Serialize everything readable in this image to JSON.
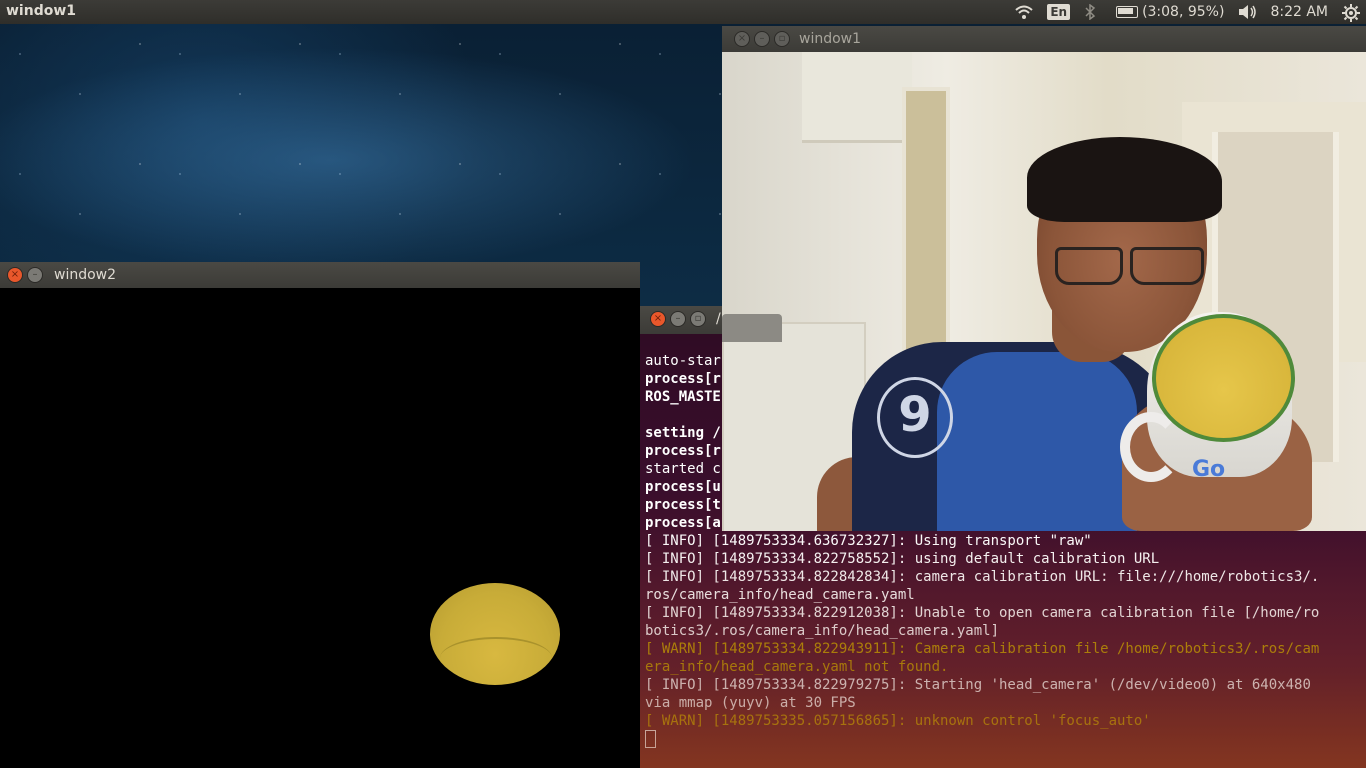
{
  "top_panel": {
    "app_title": "window1",
    "keyboard_layout": "En",
    "battery_text": "(3:08, 95%)",
    "clock": "8:22 AM",
    "icons": [
      "wifi-icon",
      "keyboard-layout-indicator",
      "bluetooth-icon",
      "battery-icon",
      "volume-icon",
      "settings-gear-icon"
    ]
  },
  "window1": {
    "title": "window1",
    "content": "webcam-feed",
    "mug_text": "Go"
  },
  "window2": {
    "title": "window2",
    "content": "thresholded-mask"
  },
  "terminal": {
    "title_fragment": "/",
    "lines": [
      {
        "text": "auto-star",
        "style": "normal"
      },
      {
        "text": "process[r",
        "style": "bold"
      },
      {
        "text": "ROS_MASTE",
        "style": "bold"
      },
      {
        "text": "",
        "style": "normal"
      },
      {
        "text": "setting /",
        "style": "bold"
      },
      {
        "text": "process[r",
        "style": "bold"
      },
      {
        "text": "started c",
        "style": "normal"
      },
      {
        "text": "process[u",
        "style": "bold"
      },
      {
        "text": "process[t",
        "style": "bold"
      },
      {
        "text": "process[a",
        "style": "bold"
      },
      {
        "text": "[ INFO] [1489753334.636732327]: Using transport \"raw\"",
        "style": "normal"
      },
      {
        "text": "[ INFO] [1489753334.822758552]: using default calibration URL",
        "style": "normal"
      },
      {
        "text": "[ INFO] [1489753334.822842834]: camera calibration URL: file:///home/robotics3/.",
        "style": "normal"
      },
      {
        "text": "ros/camera_info/head_camera.yaml",
        "style": "normal"
      },
      {
        "text": "[ INFO] [1489753334.822912038]: Unable to open camera calibration file [/home/ro",
        "style": "normal"
      },
      {
        "text": "botics3/.ros/camera_info/head_camera.yaml]",
        "style": "normal"
      },
      {
        "text": "[ WARN] [1489753334.822943911]: Camera calibration file /home/robotics3/.ros/cam",
        "style": "warn"
      },
      {
        "text": "era_info/head_camera.yaml not found.",
        "style": "warn"
      },
      {
        "text": "[ INFO] [1489753334.822979275]: Starting 'head_camera' (/dev/video0) at 640x480",
        "style": "normal"
      },
      {
        "text": "via mmap (yuyv) at 30 FPS",
        "style": "normal"
      },
      {
        "text": "[ WARN] [1489753335.057156865]: unknown control 'focus_auto'",
        "style": "warn"
      }
    ]
  }
}
